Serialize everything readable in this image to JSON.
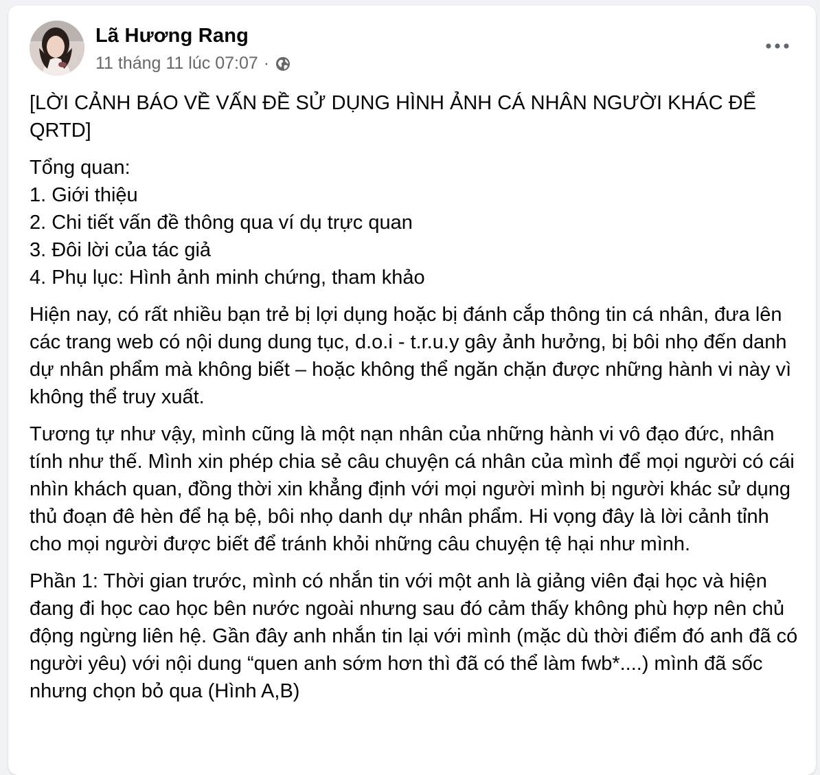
{
  "post": {
    "author_name": "Lã Hương Rang",
    "timestamp": "11 tháng 11 lúc 07:07",
    "separator": "·",
    "privacy_icon": "globe-icon",
    "more_icon": "more-horizontal-icon",
    "paragraphs": [
      "[LỜI CẢNH BÁO VỀ VẤN ĐỀ SỬ DỤNG HÌNH ẢNH CÁ NHÂN NGƯỜI KHÁC ĐỂ QRTD]",
      "Tổng quan:\n1. Giới thiệu\n2. Chi tiết vấn đề thông qua ví dụ trực quan\n3. Đôi lời của tác giả\n4. Phụ lục: Hình ảnh minh chứng, tham khảo",
      "Hiện nay, có rất nhiều bạn trẻ bị lợi dụng hoặc bị đánh cắp thông tin cá nhân, đưa lên các trang web có nội dung dung tục, d.o.i - t.r.u.y gây ảnh hưởng, bị bôi nhọ đến danh dự nhân phẩm mà không biết – hoặc không thể ngăn chặn được những hành vi này vì không thể truy xuất.",
      "Tương tự như vậy, mình cũng là một nạn nhân của những hành vi vô đạo đức, nhân tính như thế. Mình xin phép chia sẻ câu chuyện cá nhân của mình để mọi người có cái nhìn khách quan, đồng thời xin khẳng định với mọi người mình bị người khác sử dụng thủ đoạn đê hèn để hạ bệ, bôi nhọ danh dự nhân phẩm. Hi vọng đây là lời cảnh tỉnh cho mọi người được biết để tránh khỏi những câu chuyện tệ hại như mình.",
      "Phần 1: Thời gian trước, mình có nhắn tin với một anh là giảng viên đại học và hiện đang đi học cao học bên nước ngoài nhưng sau đó cảm thấy không phù hợp nên chủ động ngừng liên hệ. Gần đây anh nhắn tin lại với mình (mặc dù thời điểm đó anh đã có người yêu) với nội dung “quen anh sớm hơn thì đã có thể làm fwb*....) mình đã sốc nhưng chọn bỏ qua (Hình A,B)"
    ]
  }
}
